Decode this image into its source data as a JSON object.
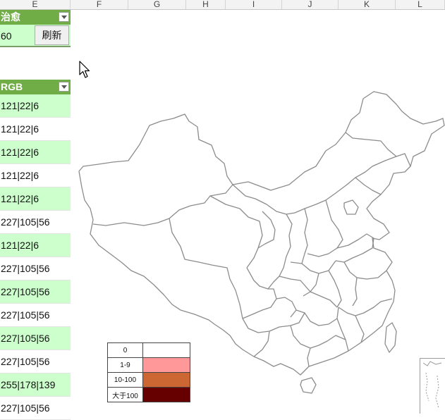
{
  "columns": [
    "E",
    "F",
    "G",
    "H",
    "I",
    "J",
    "K",
    "L"
  ],
  "table1": {
    "header": "治愈",
    "value": "60"
  },
  "refresh_label": "刷新",
  "table2": {
    "header": "RGB",
    "rows": [
      "121|22|6",
      "121|22|6",
      "121|22|6",
      "121|22|6",
      "121|22|6",
      "227|105|56",
      "121|22|6",
      "227|105|56",
      "227|105|56",
      "227|105|56",
      "227|105|56",
      "227|105|56",
      "255|178|139",
      "227|105|56"
    ]
  },
  "legend": [
    {
      "label": "0",
      "color": "#ffffff"
    },
    {
      "label": "1-9",
      "color": "#ff9999"
    },
    {
      "label": "10-100",
      "color": "#cc6633"
    },
    {
      "label": "大于100",
      "color": "#660000"
    }
  ]
}
